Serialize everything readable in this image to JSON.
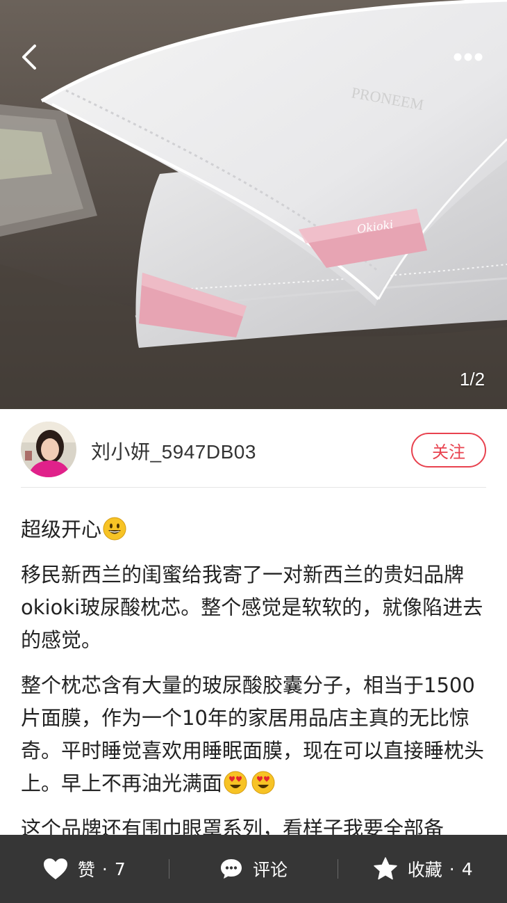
{
  "header": {
    "back_icon": "chevron-left-icon",
    "more_icon": "more-dots-icon",
    "image_counter": "1/2"
  },
  "photo": {
    "label_text": "Okioki",
    "brand_text": "PRONEEM"
  },
  "author": {
    "name": "刘小妍_5947DB03",
    "follow_label": "关注"
  },
  "post": {
    "title": "超级开心",
    "paragraph_1": "移民新西兰的闺蜜给我寄了一对新西兰的贵妇品牌okioki玻尿酸枕芯。整个感觉是软软的，就像陷进去的感觉。",
    "paragraph_2": "整个枕芯含有大量的玻尿酸胶囊分子，相当于1500片面膜，作为一个10年的家居用品店主真的无比惊奇。平时睡觉喜欢用睡眠面膜，现在可以直接睡枕头上。早上不再油光满面",
    "paragraph_3": "这个品牌还有围巾眼罩系列，看样子我要全部备"
  },
  "actions": {
    "like_label": "赞",
    "like_count": "7",
    "comment_label": "评论",
    "favorite_label": "收藏",
    "favorite_count": "4"
  },
  "colors": {
    "accent": "#e8424f",
    "bottom_bar": "#363636"
  }
}
